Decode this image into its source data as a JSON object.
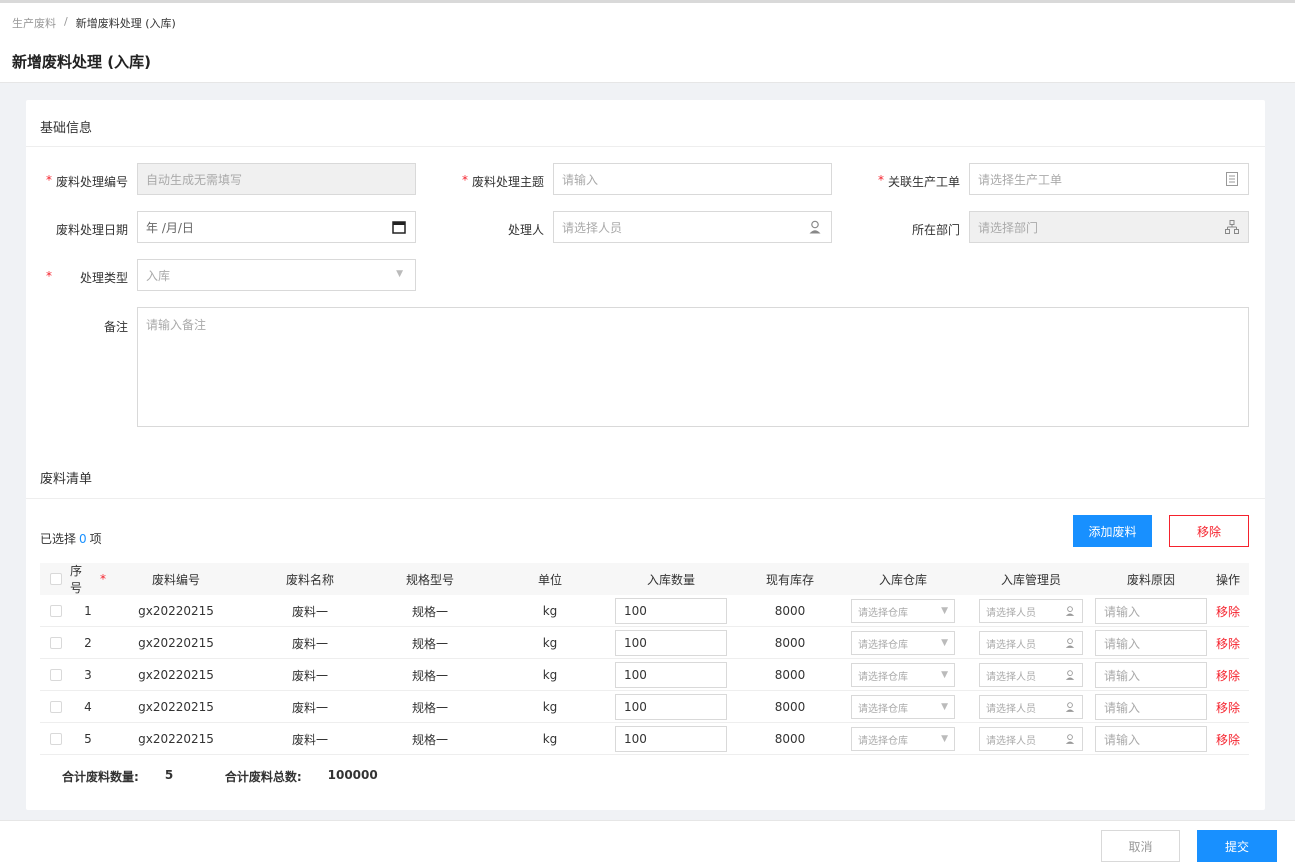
{
  "breadcrumb": {
    "parent": "生产废料",
    "separator": "/",
    "current": "新增废料处理 (入库)"
  },
  "page_title": "新增废料处理 (入库)",
  "basic_section": {
    "title": "基础信息",
    "fields": {
      "code": {
        "label": "废料处理编号",
        "placeholder": "自动生成无需填写",
        "required": true
      },
      "subject": {
        "label": "废料处理主题",
        "placeholder": "请输入",
        "required": true
      },
      "work_order": {
        "label": "关联生产工单",
        "placeholder": "请选择生产工单",
        "required": true
      },
      "date": {
        "label": "废料处理日期",
        "placeholder": "年 /月/日"
      },
      "handler": {
        "label": "处理人",
        "placeholder": "请选择人员"
      },
      "department": {
        "label": "所在部门",
        "placeholder": "请选择部门"
      },
      "type": {
        "label": "处理类型",
        "value": "入库",
        "required": true
      },
      "remark": {
        "label": "备注",
        "placeholder": "请输入备注"
      }
    }
  },
  "list_section": {
    "title": "废料清单",
    "selected_prefix": "已选择",
    "selected_count": "0",
    "selected_suffix": "项",
    "add_button": "添加废料",
    "remove_button": "移除",
    "columns": [
      "序号",
      "废料编号",
      "废料名称",
      "规格型号",
      "单位",
      "入库数量",
      "现有库存",
      "入库仓库",
      "入库管理员",
      "废料原因",
      "操作"
    ],
    "rows": [
      {
        "index": "1",
        "code": "gx20220215",
        "name": "废料一",
        "spec": "规格一",
        "unit": "kg",
        "qty": "100",
        "stock": "8000",
        "warehouse_ph": "请选择仓库",
        "manager_ph": "请选择人员",
        "reason_ph": "请输入",
        "action": "移除"
      },
      {
        "index": "2",
        "code": "gx20220215",
        "name": "废料一",
        "spec": "规格一",
        "unit": "kg",
        "qty": "100",
        "stock": "8000",
        "warehouse_ph": "请选择仓库",
        "manager_ph": "请选择人员",
        "reason_ph": "请输入",
        "action": "移除"
      },
      {
        "index": "3",
        "code": "gx20220215",
        "name": "废料一",
        "spec": "规格一",
        "unit": "kg",
        "qty": "100",
        "stock": "8000",
        "warehouse_ph": "请选择仓库",
        "manager_ph": "请选择人员",
        "reason_ph": "请输入",
        "action": "移除"
      },
      {
        "index": "4",
        "code": "gx20220215",
        "name": "废料一",
        "spec": "规格一",
        "unit": "kg",
        "qty": "100",
        "stock": "8000",
        "warehouse_ph": "请选择仓库",
        "manager_ph": "请选择人员",
        "reason_ph": "请输入",
        "action": "移除"
      },
      {
        "index": "5",
        "code": "gx20220215",
        "name": "废料一",
        "spec": "规格一",
        "unit": "kg",
        "qty": "100",
        "stock": "8000",
        "warehouse_ph": "请选择仓库",
        "manager_ph": "请选择人员",
        "reason_ph": "请输入",
        "action": "移除"
      }
    ],
    "summary": {
      "count_label": "合计废料数量:",
      "count_value": "5",
      "total_label": "合计废料总数:",
      "total_value": "100000"
    }
  },
  "footer": {
    "cancel": "取消",
    "submit": "提交"
  },
  "colors": {
    "primary": "#1890ff",
    "danger": "#f5222d"
  },
  "icons": {
    "calendar": "calendar-icon",
    "person": "person-icon",
    "doc": "document-icon",
    "org": "org-chart-icon",
    "caret": "caret-down-icon"
  }
}
